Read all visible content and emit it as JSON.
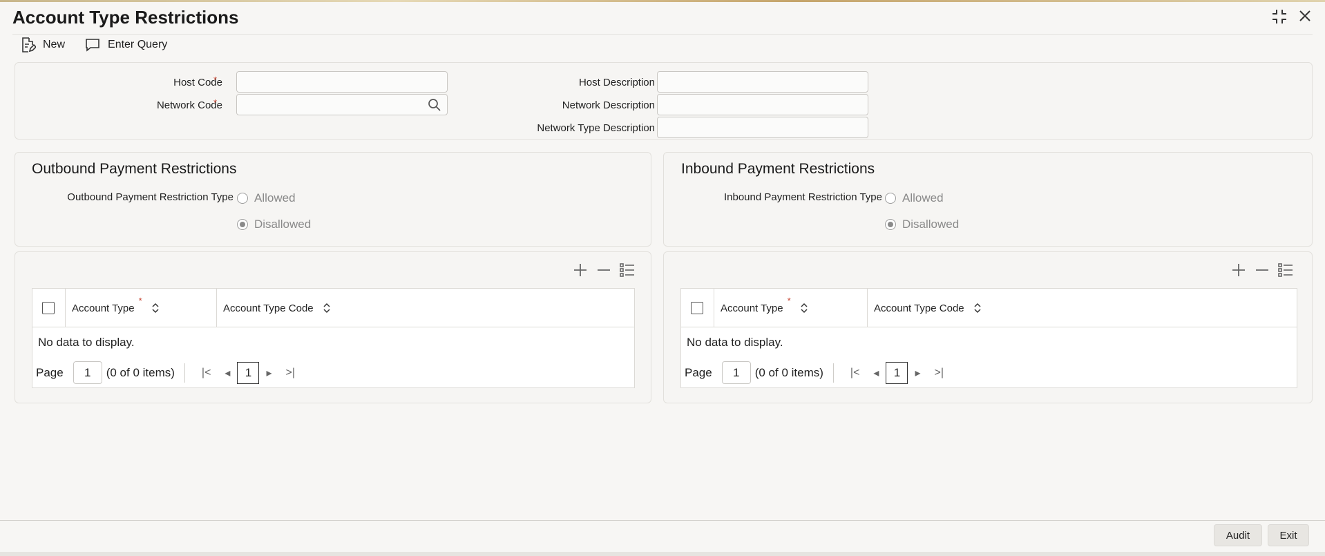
{
  "window": {
    "title": "Account Type Restrictions"
  },
  "toolbar": {
    "new_label": "New",
    "enter_query_label": "Enter Query"
  },
  "header_form": {
    "host_code_label": "Host Code",
    "network_code_label": "Network Code",
    "host_description_label": "Host Description",
    "network_description_label": "Network Description",
    "network_type_description_label": "Network Type Description",
    "required_mark": "*"
  },
  "outbound": {
    "title": "Outbound Payment Restrictions",
    "restriction_type_label": "Outbound Payment Restriction Type",
    "options": [
      "Allowed",
      "Disallowed"
    ],
    "selected": "Disallowed"
  },
  "inbound": {
    "title": "Inbound Payment Restrictions",
    "restriction_type_label": "Inbound Payment Restriction Type",
    "options": [
      "Allowed",
      "Disallowed"
    ],
    "selected": "Disallowed"
  },
  "grid": {
    "columns": [
      "Account Type",
      "Account Type Code"
    ],
    "no_data": "No data to display.",
    "page_label": "Page",
    "page_value": "1",
    "items_text": "(0 of 0 items)",
    "current_page": "1"
  },
  "footer": {
    "audit_label": "Audit",
    "exit_label": "Exit"
  }
}
